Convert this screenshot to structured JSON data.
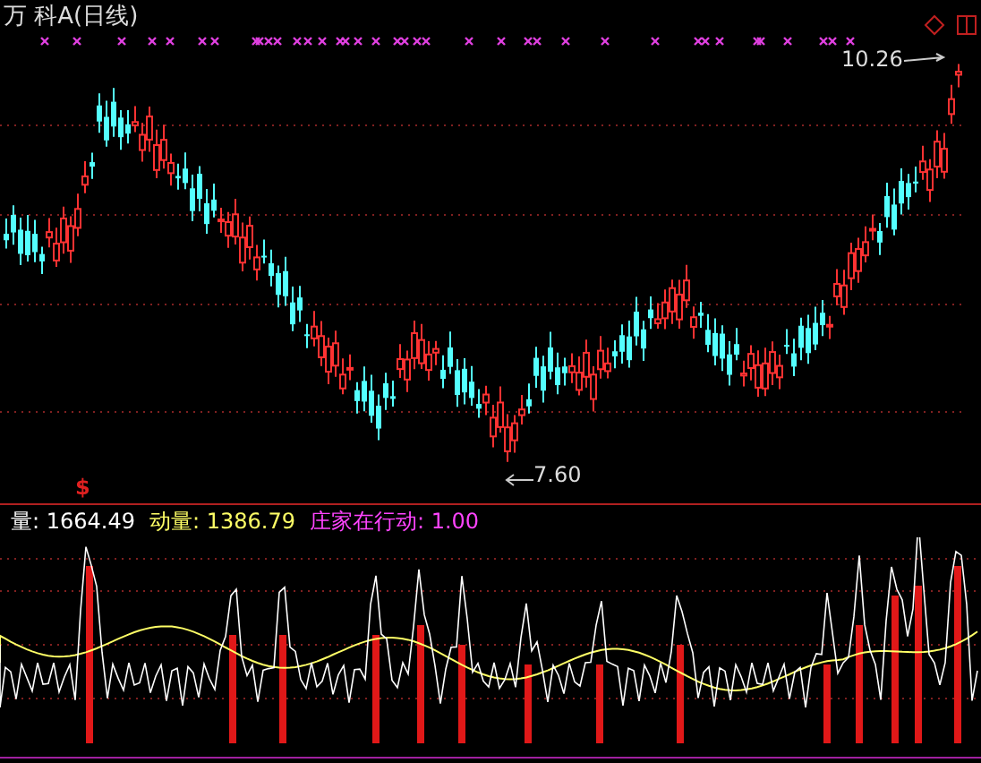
{
  "window": {
    "title": "万 科A(日线)"
  },
  "price_panel": {
    "high_label": "10.26",
    "low_label": "7.60",
    "signal_mark": "$"
  },
  "indicator": {
    "items": [
      {
        "label": "量:",
        "value": "1664.49",
        "color": "#ffffff"
      },
      {
        "label": "动量:",
        "value": "1386.79",
        "color": "#ffff66"
      },
      {
        "label": "庄家在行动:",
        "value": "1.00",
        "color": "#ff44ff"
      }
    ]
  }
}
